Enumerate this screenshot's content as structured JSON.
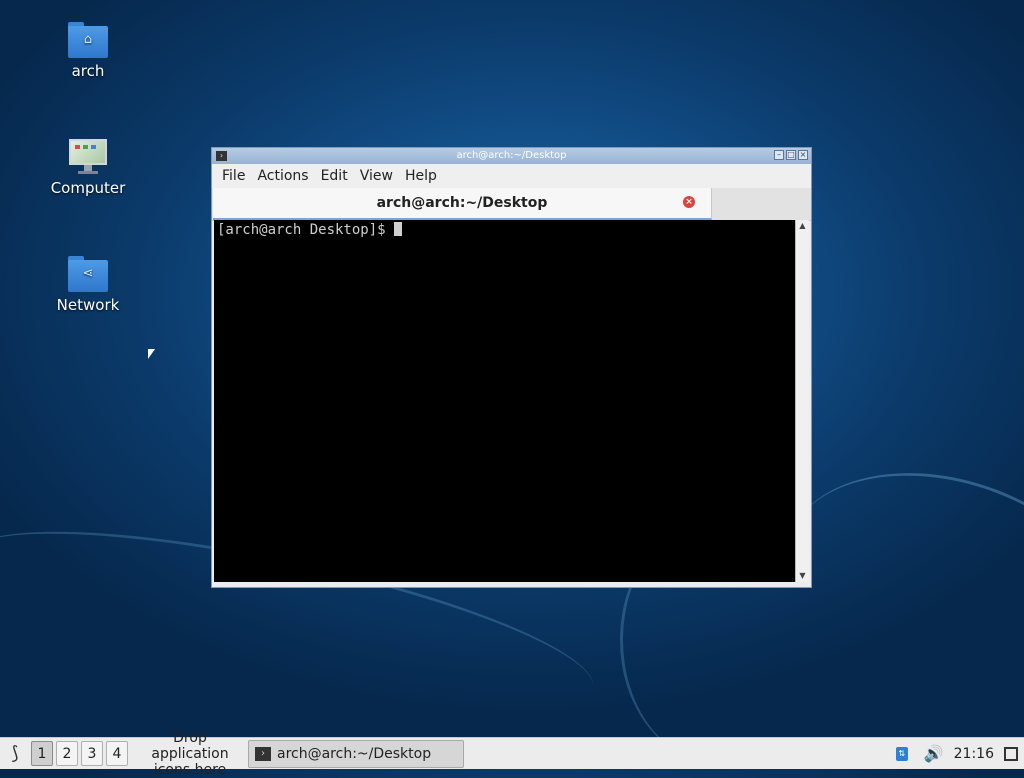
{
  "desktop": {
    "icons": [
      {
        "label": "arch",
        "icon": "home-folder-icon"
      },
      {
        "label": "Computer",
        "icon": "computer-icon"
      },
      {
        "label": "Network",
        "icon": "network-folder-icon"
      }
    ]
  },
  "window": {
    "title": "arch@arch:~/Desktop",
    "menu": [
      "File",
      "Actions",
      "Edit",
      "View",
      "Help"
    ],
    "tab_label": "arch@arch:~/Desktop",
    "prompt": "[arch@arch Desktop]$ "
  },
  "panel": {
    "workspaces": [
      "1",
      "2",
      "3",
      "4"
    ],
    "active_workspace": "1",
    "drop_text": "Drop application icons here",
    "task_label": "arch@arch:~/Desktop",
    "clock": "21:16"
  },
  "colors": {
    "accent": "#2f77cc",
    "close": "#d9453f"
  }
}
